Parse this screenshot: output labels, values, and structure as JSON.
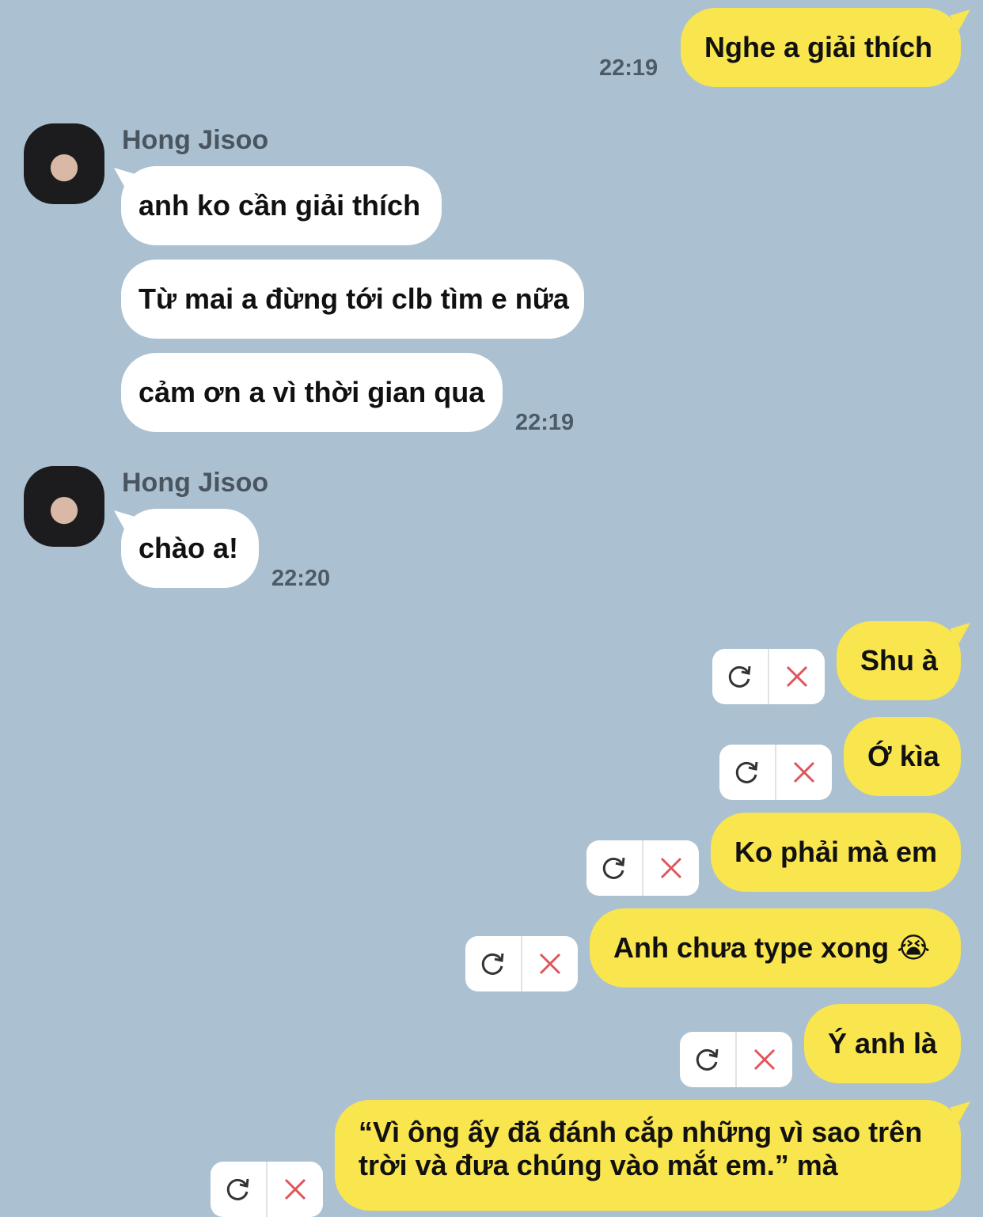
{
  "messages": {
    "m1": {
      "text": "Nghe a giải thích",
      "time": "22:19"
    },
    "g1_name": "Hong Jisoo",
    "g1_m1": "anh ko cần giải thích",
    "g1_m2": "Từ mai a đừng tới clb tìm e nữa",
    "g1_m3": "cảm ơn a vì thời gian qua",
    "g1_time": "22:19",
    "g2_name": "Hong Jisoo",
    "g2_m1": "chào a!",
    "g2_time": "22:20",
    "f1": "Shu à",
    "f2": "Ớ kìa",
    "f3": "Ko phải mà em",
    "f4": "Anh chưa type xong 😭",
    "f5": "Ý anh là",
    "f6_line1": "“Vì ông ấy đã đánh cắp những vì sao trên",
    "f6_line2": "trời và đưa chúng vào mắt em.” mà"
  },
  "icons": {
    "retry": "retry-icon",
    "delete": "close-icon"
  },
  "colors": {
    "background": "#abc1d1",
    "my_bubble": "#f9e54e",
    "their_bubble": "#ffffff",
    "delete_x": "#e0555a"
  }
}
